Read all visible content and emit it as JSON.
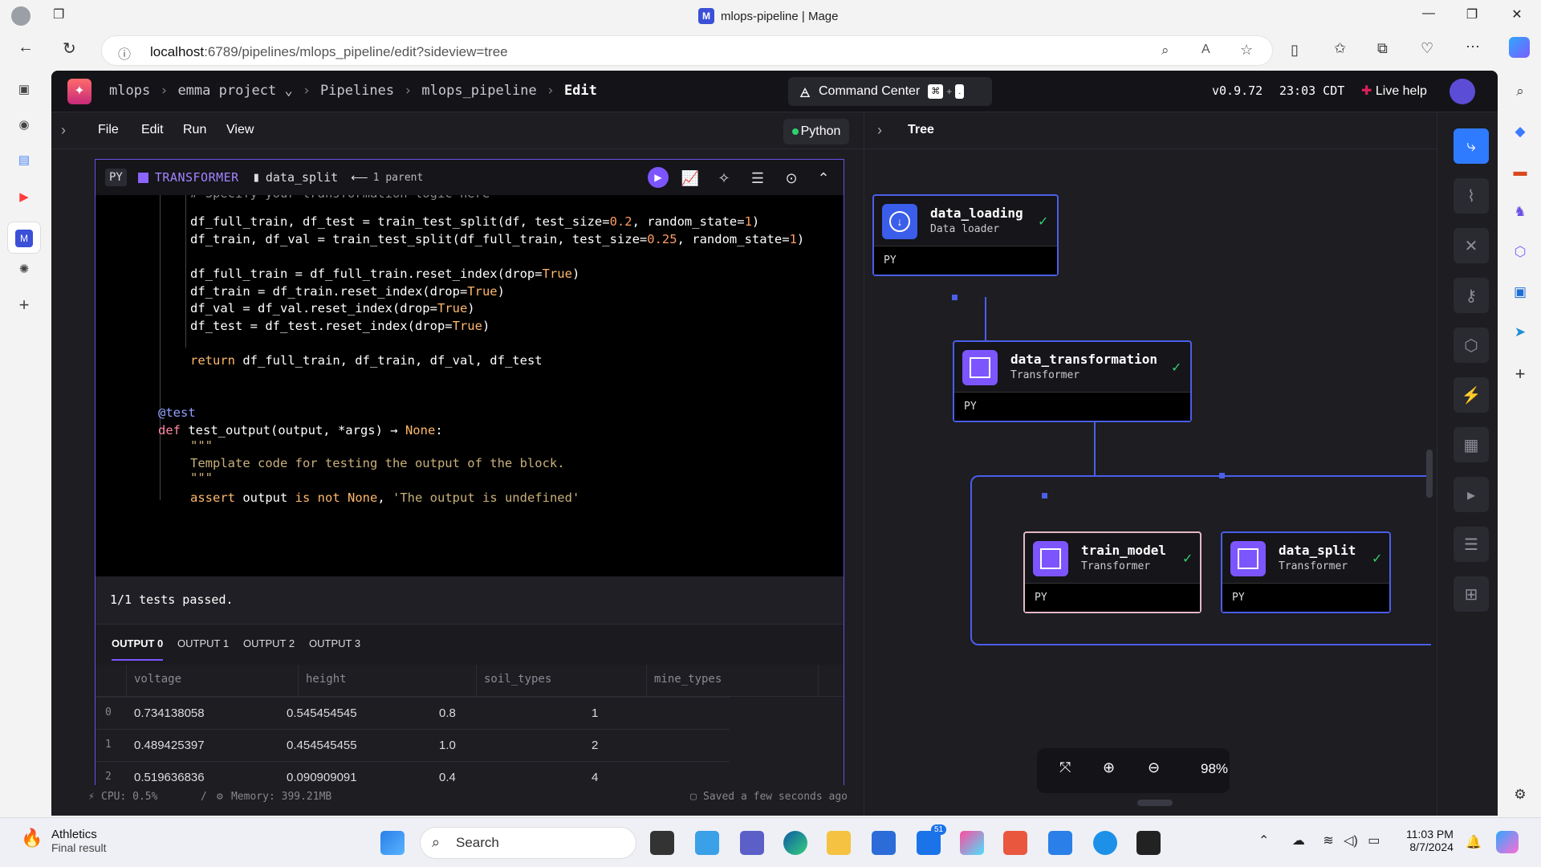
{
  "window": {
    "title": "mlops-pipeline | Mage"
  },
  "browser": {
    "url_host": "localhost",
    "url_rest": ":6789/pipelines/mlops_pipeline/edit?sideview=tree"
  },
  "header": {
    "breadcrumb": [
      "mlops",
      "emma project",
      "Pipelines",
      "mlops_pipeline",
      "Edit"
    ],
    "command_center": "Command Center",
    "kbd1": "⌘",
    "kbd_plus": "+",
    "kbd2": ".",
    "version": "v0.9.72",
    "clock": "23:03 CDT",
    "live_help": "Live help"
  },
  "menu": {
    "items": [
      "File",
      "Edit",
      "Run",
      "View"
    ],
    "language": "Python"
  },
  "block": {
    "lang_badge": "PY",
    "type": "TRANSFORMER",
    "name": "data_split",
    "parents": "1 parent"
  },
  "code": {
    "comment_partial": "# Specify your transformation logic here",
    "l1_a": "df_full_train, df_test = train_test_split(df, test_size=",
    "l1_n1": "0.2",
    "l1_b": ", random_state=",
    "l1_n2": "1",
    "l1_c": ")",
    "l2_a": "df_train, df_val = train_test_split(df_full_train, test_size=",
    "l2_n1": "0.25",
    "l2_b": ", random_state=",
    "l2_n2": "1",
    "l2_c": ")",
    "l3_a": "df_full_train = df_full_train.reset_index(drop=",
    "l3_v": "True",
    "l3_c": ")",
    "l4_a": "df_train = df_train.reset_index(drop=",
    "l4_v": "True",
    "l4_c": ")",
    "l5_a": "df_val = df_val.reset_index(drop=",
    "l5_v": "True",
    "l5_c": ")",
    "l6_a": "df_test = df_test.reset_index(drop=",
    "l6_v": "True",
    "l6_c": ")",
    "l7_kw": "return",
    "l7_rest": " df_full_train, df_train, df_val, df_test",
    "decorator": "@test",
    "def_kw": "def",
    "def_name": " test_output",
    "def_args": "(output, *args) ",
    "def_arrow": "→",
    "def_ret": " None",
    "def_colon": ":",
    "doc_open": "\"\"\"",
    "doc_text": "Template code for testing the output of the block.",
    "doc_close": "\"\"\"",
    "assert_kw": "assert",
    "assert_mid": " output ",
    "assert_isnot": "is not",
    "assert_none": " None",
    "assert_comma": ", ",
    "assert_str": "'The output is undefined'"
  },
  "tests": {
    "result": "1/1 tests passed."
  },
  "outputs": {
    "tabs": [
      "OUTPUT 0",
      "OUTPUT 1",
      "OUTPUT 2",
      "OUTPUT 3"
    ],
    "columns": [
      "voltage",
      "height",
      "soil_types",
      "mine_types"
    ],
    "rows": [
      {
        "idx": "0",
        "cells": [
          "0.734138058",
          "0.545454545",
          "0.8",
          "1"
        ]
      },
      {
        "idx": "1",
        "cells": [
          "0.489425397",
          "0.454545455",
          "1.0",
          "2"
        ]
      },
      {
        "idx": "2",
        "cells": [
          "0.519636836",
          "0.090909091",
          "0.4",
          "4"
        ]
      }
    ]
  },
  "status": {
    "cpu": "CPU: 0.5%",
    "sep": "/",
    "memory": "Memory: 399.21MB",
    "saved": "Saved a few seconds ago"
  },
  "tree": {
    "title": "Tree",
    "nodes": [
      {
        "name": "data_loading",
        "type": "Data loader",
        "lang": "PY"
      },
      {
        "name": "data_transformation",
        "type": "Transformer",
        "lang": "PY"
      },
      {
        "name": "train_model",
        "type": "Transformer",
        "lang": "PY"
      },
      {
        "name": "data_split",
        "type": "Transformer",
        "lang": "PY"
      }
    ],
    "zoom": "98%"
  },
  "taskbar": {
    "weather_title": "Athletics",
    "weather_sub": "Final result",
    "search": "Search",
    "mail_badge": "51",
    "time": "11:03 PM",
    "date": "8/7/2024"
  },
  "colors": {
    "accent": "#7d55ff",
    "node_border": "#4b5ee8",
    "success": "#34d16e"
  }
}
